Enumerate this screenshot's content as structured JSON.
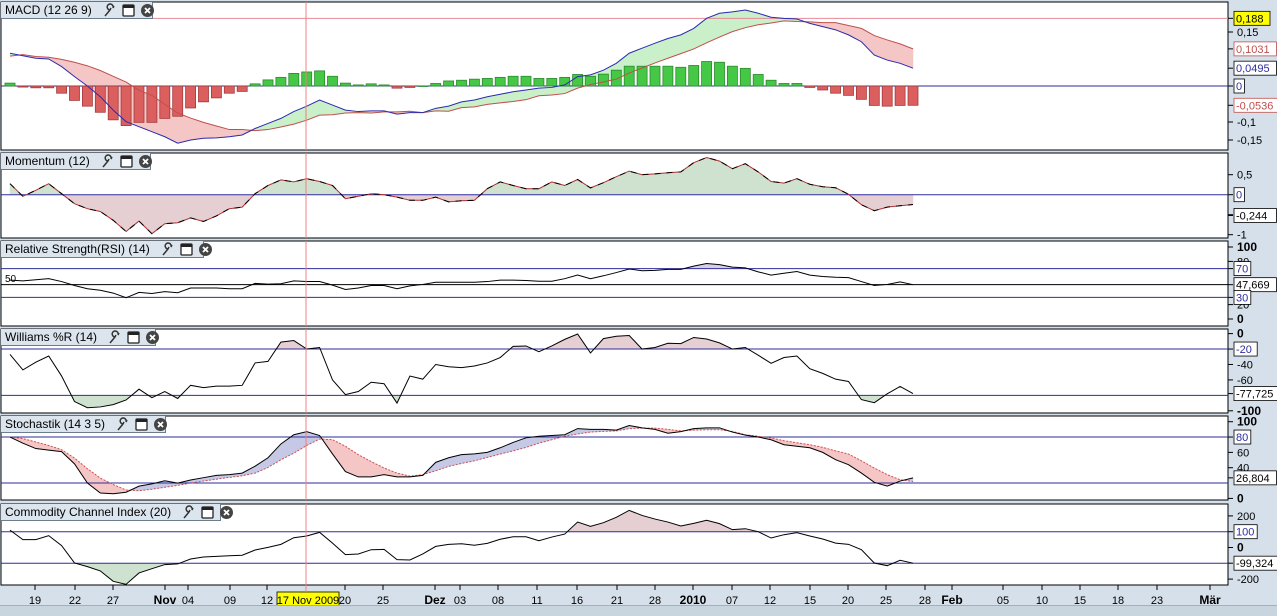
{
  "colors": {
    "macd_line": "#2b2bb0",
    "signal_line": "#c0504d",
    "hist_pos": "#45c845",
    "hist_pos_border": "#2b8a2b",
    "hist_neg": "#dc5f5f",
    "hist_neg_border": "#a33a3a",
    "fill_green": "#c9f0c9",
    "fill_pink": "#f5c6c6",
    "fill_momo_pos": "#cfe2cf",
    "fill_momo_neg": "#e6cfd2",
    "fill_lavender": "#d9cde6",
    "fill_blue": "#c6c9e6",
    "ref_blue": "#2e2e9e",
    "ref_pink": "#e88a9a",
    "crosshair": "#f08080",
    "highlight": "#ffff00"
  },
  "chart_data": [
    {
      "id": "macd",
      "type": "bar+line",
      "title": "MACD (12 26 9)",
      "series": [
        {
          "name": "MACD",
          "values": [
            0.091,
            0.084,
            0.077,
            0.075,
            0.054,
            0.026,
            0,
            -0.03,
            -0.067,
            -0.099,
            -0.113,
            -0.127,
            -0.141,
            -0.159,
            -0.15,
            -0.145,
            -0.144,
            -0.141,
            -0.136,
            -0.118,
            -0.104,
            -0.09,
            -0.071,
            -0.056,
            -0.039,
            -0.053,
            -0.067,
            -0.071,
            -0.069,
            -0.069,
            -0.078,
            -0.074,
            -0.074,
            -0.062,
            -0.056,
            -0.044,
            -0.039,
            -0.03,
            -0.023,
            -0.016,
            -0.011,
            -0.006,
            -0.004,
            0.003,
            0.026,
            0.031,
            0.044,
            0.063,
            0.091,
            0.105,
            0.119,
            0.132,
            0.142,
            0.16,
            0.188,
            0.202,
            0.206,
            0.211,
            0.202,
            0.191,
            0.188,
            0.186,
            0.174,
            0.165,
            0.156,
            0.142,
            0.123,
            0.086,
            0.072,
            0.063,
            0.0495
          ]
        },
        {
          "name": "Histogram",
          "values": [
            0.008,
            -0.003,
            -0.005,
            -0.005,
            -0.02,
            -0.04,
            -0.056,
            -0.073,
            -0.094,
            -0.11,
            -0.101,
            -0.101,
            -0.09,
            -0.084,
            -0.061,
            -0.044,
            -0.033,
            -0.02,
            -0.015,
            0.006,
            0.017,
            0.024,
            0.035,
            0.039,
            0.042,
            0.027,
            0.008,
            0.003,
            0.006,
            0.003,
            -0.006,
            -0.004,
            0,
            0.007,
            0.014,
            0.016,
            0.019,
            0.021,
            0.024,
            0.027,
            0.027,
            0.021,
            0.021,
            0.024,
            0.032,
            0.027,
            0.033,
            0.044,
            0.055,
            0.055,
            0.055,
            0.055,
            0.052,
            0.057,
            0.068,
            0.066,
            0.055,
            0.049,
            0.032,
            0.016,
            0.007,
            0.007,
            -0.004,
            -0.011,
            -0.02,
            -0.026,
            -0.037,
            -0.054,
            -0.056,
            -0.054,
            -0.0536
          ]
        }
      ],
      "signal_rule": "signal = MACD - Histogram",
      "ylim": [
        -0.17,
        0.23
      ],
      "yticks": [
        {
          "value": 0.15,
          "label": "0,15"
        },
        {
          "value": -0.1,
          "label": "-0,1"
        },
        {
          "value": -0.15,
          "label": "-0,15"
        }
      ],
      "markers": [
        {
          "value": 0.188,
          "label": "0,188",
          "style": "yellow"
        },
        {
          "value": 0.1031,
          "label": "0,1031",
          "style": "red"
        },
        {
          "value": 0.0495,
          "label": "0,0495",
          "style": "blue"
        },
        {
          "value": 0,
          "label": "0",
          "style": "blue"
        },
        {
          "value": -0.0536,
          "label": "-0,0536",
          "style": "red"
        }
      ],
      "reference_lines": [
        {
          "value": 0.188,
          "color": "#e88a9a"
        },
        {
          "value": 0,
          "color": "#2e2e9e"
        }
      ]
    },
    {
      "id": "momentum",
      "type": "line",
      "title": "Momentum (12)",
      "series": [
        {
          "name": "Momentum",
          "values": [
            0.275,
            -0.04,
            0.11,
            0.275,
            0.025,
            -0.225,
            -0.35,
            -0.42,
            -0.64,
            -0.92,
            -0.66,
            -0.975,
            -0.725,
            -0.7,
            -0.58,
            -0.67,
            -0.53,
            -0.35,
            -0.31,
            0.025,
            0.23,
            0.37,
            0.32,
            0.4,
            0.33,
            0.23,
            -0.1,
            -0.04,
            0.025,
            0,
            -0.06,
            -0.14,
            -0.14,
            -0.06,
            -0.18,
            -0.15,
            -0.14,
            0.15,
            0.32,
            0.23,
            0.15,
            0.15,
            0.32,
            0.23,
            0.38,
            0.17,
            0.3,
            0.45,
            0.59,
            0.5,
            0.52,
            0.55,
            0.57,
            0.8,
            0.93,
            0.84,
            0.65,
            0.775,
            0.57,
            0.33,
            0.29,
            0.4,
            0.26,
            0.2,
            0.175,
            0.01,
            -0.25,
            -0.4,
            -0.31,
            -0.275,
            -0.244
          ]
        }
      ],
      "ylim": [
        -1.05,
        1
      ],
      "yticks": [
        {
          "value": 0.5,
          "label": "0,5"
        },
        {
          "value": -0.5,
          "label": "-0,5"
        },
        {
          "value": -1,
          "label": "-1"
        }
      ],
      "markers": [
        {
          "value": 0,
          "label": "0",
          "style": "blue"
        },
        {
          "value": -0.244,
          "label": "-0,244",
          "style": "black",
          "offset": 11
        }
      ],
      "reference_lines": [
        {
          "value": 0,
          "color": "#2e2e9e"
        }
      ]
    },
    {
      "id": "rsi",
      "type": "line",
      "title": "Relative Strength(RSI) (14)",
      "series": [
        {
          "name": "RSI",
          "values": [
            54,
            53,
            54.5,
            56,
            52,
            46.5,
            42,
            40,
            36,
            29.5,
            37,
            35.5,
            38,
            36.5,
            43,
            43,
            43,
            42,
            42,
            49.5,
            48.5,
            49,
            53,
            52,
            52,
            47,
            41,
            43,
            46.5,
            46.5,
            42,
            46,
            48,
            51,
            51,
            51,
            51,
            52,
            54,
            54,
            53.5,
            52.5,
            52.5,
            56,
            61,
            56,
            60,
            64.5,
            69.5,
            67,
            67.5,
            69,
            69,
            73.5,
            77,
            75.5,
            72,
            71,
            65.5,
            61,
            63.5,
            66,
            61,
            59,
            58,
            57.5,
            52,
            46.5,
            48,
            51.5,
            47.669
          ]
        }
      ],
      "ylim": [
        0,
        100
      ],
      "inline_label": "50",
      "yticks": [
        {
          "value": 100,
          "label": "100",
          "bold": true
        },
        {
          "value": 80,
          "label": "80"
        },
        {
          "value": 20,
          "label": "20"
        },
        {
          "value": 0,
          "label": "0",
          "bold": true
        }
      ],
      "markers": [
        {
          "value": 70,
          "label": "70",
          "style": "blue"
        },
        {
          "value": 47.669,
          "label": "47,669",
          "style": "black"
        },
        {
          "value": 30,
          "label": "30",
          "style": "blue"
        }
      ],
      "reference_lines": [
        {
          "value": 70,
          "color": "#2e2e9e"
        },
        {
          "value": 47.669,
          "color": "#000000"
        },
        {
          "value": 30,
          "color": "#2e2e9e"
        }
      ]
    },
    {
      "id": "williams",
      "type": "line",
      "title": "Williams %R (14)",
      "series": [
        {
          "name": "%R",
          "values": [
            -27,
            -47,
            -37,
            -29,
            -55,
            -88,
            -96,
            -95,
            -92,
            -86,
            -72,
            -83,
            -75,
            -84,
            -67,
            -70,
            -68,
            -68,
            -67,
            -38,
            -36,
            -11,
            -9,
            -20,
            -18,
            -60,
            -79,
            -75,
            -63,
            -65,
            -90,
            -55,
            -59,
            -40,
            -43,
            -44,
            -42,
            -38,
            -31,
            -16.5,
            -16,
            -23.5,
            -16,
            -7.5,
            -0.5,
            -25,
            -6.5,
            -3.5,
            -2.5,
            -20,
            -18,
            -12.5,
            -13,
            -5,
            -7,
            -12,
            -20,
            -18,
            -28,
            -38.5,
            -31,
            -29,
            -45.5,
            -51.5,
            -59,
            -62,
            -85.5,
            -89.5,
            -78,
            -68.5,
            -77.725
          ]
        }
      ],
      "ylim": [
        -100,
        0
      ],
      "yticks": [
        {
          "value": 0,
          "label": "0",
          "bold": true
        },
        {
          "value": -40,
          "label": "-40"
        },
        {
          "value": -60,
          "label": "-60"
        },
        {
          "value": -100,
          "label": "-100",
          "bold": true
        }
      ],
      "markers": [
        {
          "value": -20,
          "label": "-20",
          "style": "blue"
        },
        {
          "value": -77.725,
          "label": "-77,725",
          "style": "black"
        }
      ],
      "reference_lines": [
        {
          "value": -20,
          "color": "#2e2e9e"
        },
        {
          "value": -80,
          "color": "#2e2e9e"
        }
      ]
    },
    {
      "id": "stoch",
      "type": "line",
      "title": "Stochastik (14 3 5)",
      "series": [
        {
          "name": "%K",
          "values": [
            80,
            72,
            65,
            63,
            61,
            45,
            20,
            7,
            6,
            8,
            16,
            19,
            23,
            20,
            24,
            27,
            30,
            31,
            33,
            42,
            53,
            71,
            83,
            87,
            82,
            58,
            35,
            28,
            28,
            31,
            28,
            28,
            30,
            47,
            53,
            57,
            58,
            60,
            66,
            73,
            79,
            81,
            82,
            83,
            91,
            90,
            90,
            89,
            95,
            92,
            90,
            85,
            87,
            91,
            92,
            92,
            86.5,
            82.5,
            80,
            76.5,
            70,
            68,
            66,
            60,
            50.5,
            44,
            33,
            21,
            16,
            22.6,
            26.804
          ]
        },
        {
          "name": "%D",
          "values": [
            80,
            78,
            73.5,
            69,
            63.5,
            52.6,
            38.7,
            26.5,
            18,
            11,
            10,
            12,
            14.5,
            17,
            20,
            22.6,
            25,
            27.4,
            29.5,
            33,
            40.4,
            50.4,
            59,
            69,
            77.4,
            76.5,
            68,
            57,
            48,
            39.6,
            33,
            29,
            31,
            36,
            41.7,
            45.6,
            49,
            53.5,
            57.8,
            62,
            66.5,
            72,
            76.5,
            81,
            84,
            86.5,
            87.4,
            88,
            91,
            91.7,
            91.7,
            90,
            88,
            89,
            89.5,
            89.5,
            87.4,
            83,
            81,
            78.7,
            75.2,
            72.6,
            70,
            66.5,
            62,
            57.8,
            49,
            39.6,
            31,
            24.3,
            22
          ]
        }
      ],
      "ylim": [
        0,
        100
      ],
      "yticks": [
        {
          "value": 100,
          "label": "100",
          "bold": true
        },
        {
          "value": 60,
          "label": "60"
        },
        {
          "value": 40,
          "label": "40"
        },
        {
          "value": 0,
          "label": "0",
          "bold": true
        }
      ],
      "markers": [
        {
          "value": 80,
          "label": "80",
          "style": "blue"
        },
        {
          "value": 26.804,
          "label": "26,804",
          "style": "black"
        }
      ],
      "reference_lines": [
        {
          "value": 80,
          "color": "#2e2e9e"
        },
        {
          "value": 20,
          "color": "#2e2e9e"
        }
      ]
    },
    {
      "id": "cci",
      "type": "line",
      "title": "Commodity Channel Index (20)",
      "series": [
        {
          "name": "CCI",
          "values": [
            110,
            50,
            50,
            75,
            12,
            -98,
            -121,
            -148,
            -214,
            -233,
            -161,
            -134,
            -108,
            -104,
            -73,
            -60,
            -56,
            -52,
            -49,
            -16,
            1,
            20,
            62,
            73,
            96,
            28,
            -45,
            -41,
            -14,
            -12,
            -77,
            -79,
            -41,
            7,
            20,
            24,
            14,
            26,
            52,
            68,
            68,
            43,
            66,
            85,
            161,
            134,
            157,
            191,
            235,
            203,
            180,
            161,
            136,
            153,
            172,
            151,
            113,
            119,
            100,
            60,
            81,
            94,
            73,
            54,
            28,
            20,
            -14,
            -98,
            -115,
            -81,
            -99.324
          ]
        }
      ],
      "ylim": [
        -250,
        250
      ],
      "yticks": [
        {
          "value": 200,
          "label": "200"
        },
        {
          "value": 0,
          "label": "0",
          "bold": true
        },
        {
          "value": -200,
          "label": "-200"
        }
      ],
      "markers": [
        {
          "value": 100,
          "label": "100",
          "style": "blue"
        },
        {
          "value": -99.324,
          "label": "-99,324",
          "style": "black"
        }
      ],
      "reference_lines": [
        {
          "value": 100,
          "color": "#2e2e9e"
        },
        {
          "value": -100,
          "color": "#2e2e9e"
        }
      ]
    }
  ],
  "date_axis": {
    "ticks": [
      {
        "label": "19"
      },
      {
        "label": "22"
      },
      {
        "label": "27"
      },
      {
        "label": "Nov",
        "bold": true
      },
      {
        "label": "04"
      },
      {
        "label": "09"
      },
      {
        "label": "12"
      },
      {
        "label": "20"
      },
      {
        "label": "25"
      },
      {
        "label": "Dez",
        "bold": true
      },
      {
        "label": "03"
      },
      {
        "label": "08"
      },
      {
        "label": "11"
      },
      {
        "label": "16"
      },
      {
        "label": "21"
      },
      {
        "label": "28"
      },
      {
        "label": "2010",
        "bold": true
      },
      {
        "label": "07"
      },
      {
        "label": "12"
      },
      {
        "label": "15"
      },
      {
        "label": "20"
      },
      {
        "label": "25"
      },
      {
        "label": "28"
      },
      {
        "label": "Feb",
        "bold": true
      },
      {
        "label": "05"
      },
      {
        "label": "10"
      },
      {
        "label": "15"
      },
      {
        "label": "18"
      },
      {
        "label": "23"
      },
      {
        "label": "Mär",
        "bold": true
      }
    ],
    "crosshair_label": "17 Nov 2009"
  }
}
